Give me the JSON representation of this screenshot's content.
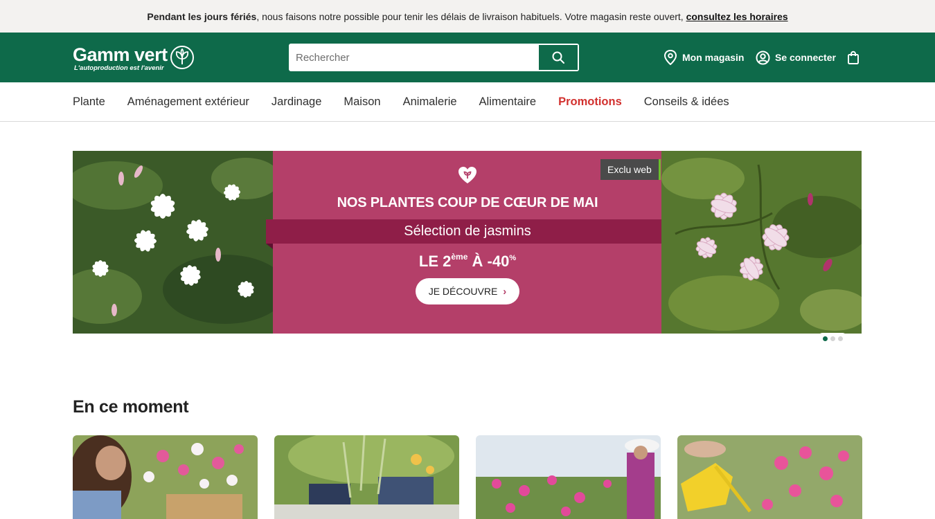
{
  "banner": {
    "bold_text": "Pendant les jours fériés",
    "text": ", nous faisons notre possible pour tenir les délais de livraison habituels. Votre magasin reste ouvert, ",
    "link_text": "consultez les horaires"
  },
  "header": {
    "logo_name": "Gamm vert",
    "logo_tagline": "L'autoproduction est l'avenir",
    "search_placeholder": "Rechercher",
    "store_label": "Mon magasin",
    "login_label": "Se connecter"
  },
  "nav": {
    "items": [
      "Plante",
      "Aménagement extérieur",
      "Jardinage",
      "Maison",
      "Animalerie",
      "Alimentaire",
      "Promotions",
      "Conseils & idées"
    ]
  },
  "hero": {
    "badge": "Exclu web",
    "title": "NOS PLANTES COUP DE CŒUR DE MAI",
    "ribbon": "Sélection de jasmins",
    "offer_prefix": "LE 2",
    "offer_sup": "ème",
    "offer_middle": " À -40",
    "offer_pct": "%",
    "cta": "JE DÉCOUVRE",
    "slides": 3,
    "active_slide": 1
  },
  "section": {
    "title": "En ce moment"
  },
  "colors": {
    "brand_green": "#0e6a4a",
    "promo_red": "#d2312f",
    "hero_pink": "#b43f69",
    "ribbon": "#8f1e48"
  },
  "icons": [
    "leaf-logo-icon",
    "search-icon",
    "location-pin-icon",
    "user-icon",
    "bag-icon",
    "heart-icon",
    "chevron-right-icon"
  ]
}
